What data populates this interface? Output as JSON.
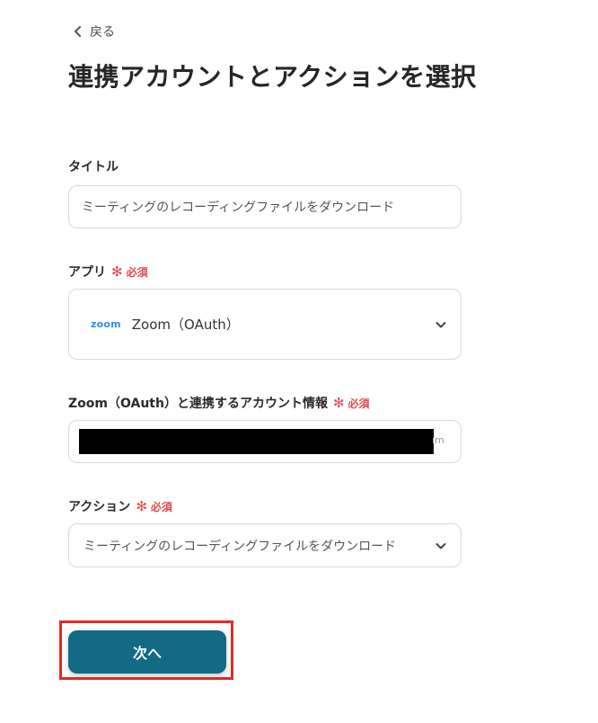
{
  "header": {
    "back_label": "戻る",
    "title": "連携アカウントとアクションを選択"
  },
  "required_label": "必須",
  "fields": {
    "title": {
      "label": "タイトル",
      "value": "ミーティングのレコーディングファイルをダウンロード"
    },
    "app": {
      "label": "アプリ",
      "logo_text": "zoom",
      "value": "Zoom（OAuth）"
    },
    "account": {
      "label": "Zoom（OAuth）と連携するアカウント情報",
      "visible_tail": "ım"
    },
    "action": {
      "label": "アクション",
      "value": "ミーティングのレコーディングファイルをダウンロード"
    }
  },
  "buttons": {
    "next_label": "次へ"
  },
  "colors": {
    "primary": "#126a84",
    "required": "#e5484d",
    "highlight": "#e02b27",
    "zoom_blue": "#2d8cff"
  }
}
